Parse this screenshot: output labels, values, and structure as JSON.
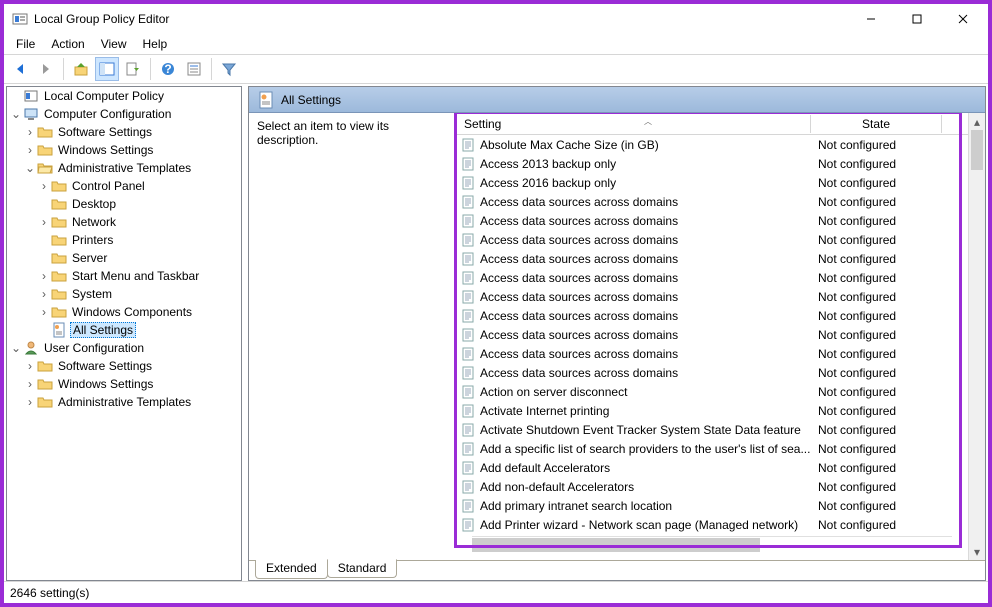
{
  "window": {
    "title": "Local Group Policy Editor"
  },
  "menu": {
    "file": "File",
    "action": "Action",
    "view": "View",
    "help": "Help"
  },
  "tree": {
    "root": "Local Computer Policy",
    "computer_config": "Computer Configuration",
    "cc_software": "Software Settings",
    "cc_windows": "Windows Settings",
    "cc_admin": "Administrative Templates",
    "cc_cp": "Control Panel",
    "cc_desktop": "Desktop",
    "cc_network": "Network",
    "cc_printers": "Printers",
    "cc_server": "Server",
    "cc_start": "Start Menu and Taskbar",
    "cc_system": "System",
    "cc_wincomp": "Windows Components",
    "cc_all": "All Settings",
    "user_config": "User Configuration",
    "uc_software": "Software Settings",
    "uc_windows": "Windows Settings",
    "uc_admin": "Administrative Templates"
  },
  "content": {
    "header": "All Settings",
    "description_prompt": "Select an item to view its description.",
    "col_setting": "Setting",
    "col_state": "State",
    "tab_extended": "Extended",
    "tab_standard": "Standard"
  },
  "settings": [
    {
      "name": "Absolute Max Cache Size (in GB)",
      "state": "Not configured"
    },
    {
      "name": "Access 2013 backup only",
      "state": "Not configured"
    },
    {
      "name": "Access 2016 backup only",
      "state": "Not configured"
    },
    {
      "name": "Access data sources across domains",
      "state": "Not configured"
    },
    {
      "name": "Access data sources across domains",
      "state": "Not configured"
    },
    {
      "name": "Access data sources across domains",
      "state": "Not configured"
    },
    {
      "name": "Access data sources across domains",
      "state": "Not configured"
    },
    {
      "name": "Access data sources across domains",
      "state": "Not configured"
    },
    {
      "name": "Access data sources across domains",
      "state": "Not configured"
    },
    {
      "name": "Access data sources across domains",
      "state": "Not configured"
    },
    {
      "name": "Access data sources across domains",
      "state": "Not configured"
    },
    {
      "name": "Access data sources across domains",
      "state": "Not configured"
    },
    {
      "name": "Access data sources across domains",
      "state": "Not configured"
    },
    {
      "name": "Action on server disconnect",
      "state": "Not configured"
    },
    {
      "name": "Activate Internet printing",
      "state": "Not configured"
    },
    {
      "name": "Activate Shutdown Event Tracker System State Data feature",
      "state": "Not configured"
    },
    {
      "name": "Add a specific list of search providers to the user's list of sea...",
      "state": "Not configured"
    },
    {
      "name": "Add default Accelerators",
      "state": "Not configured"
    },
    {
      "name": "Add non-default Accelerators",
      "state": "Not configured"
    },
    {
      "name": "Add primary intranet search location",
      "state": "Not configured"
    },
    {
      "name": "Add Printer wizard - Network scan page (Managed network)",
      "state": "Not configured"
    }
  ],
  "status": {
    "count": "2646 setting(s)"
  }
}
